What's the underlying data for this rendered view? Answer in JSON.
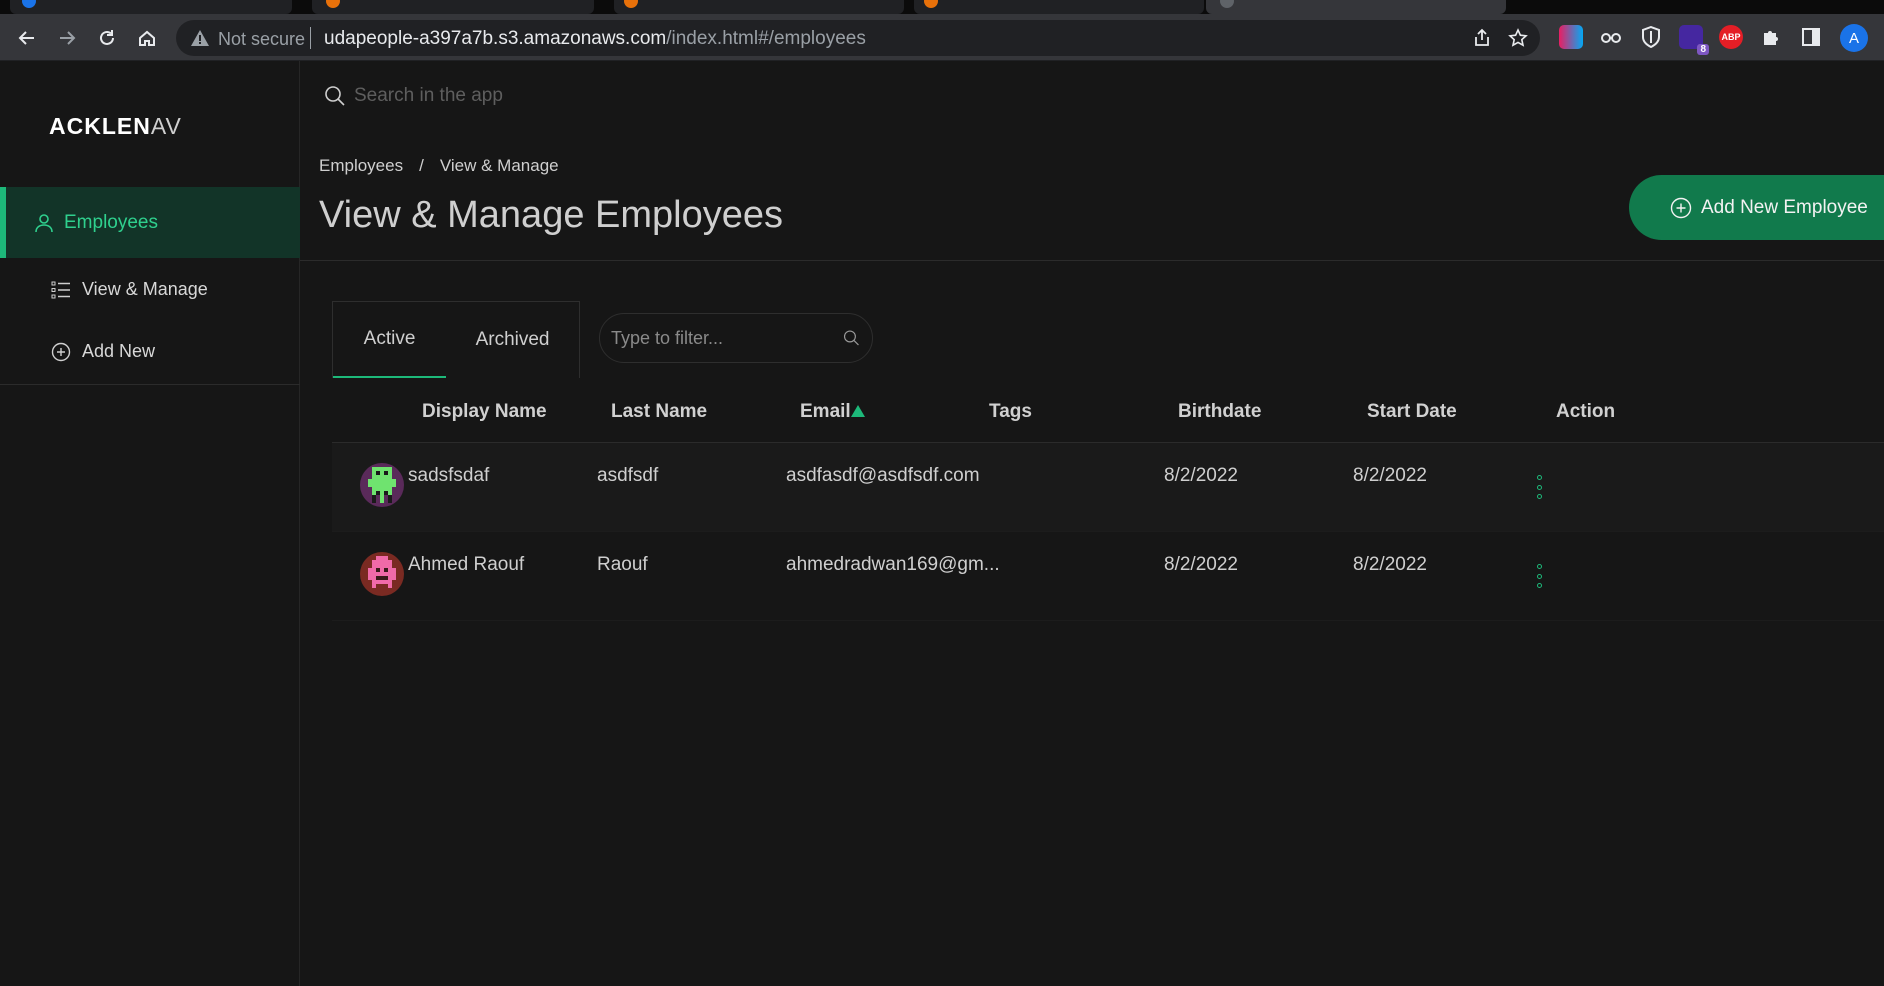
{
  "browser": {
    "secure_label": "Not secure",
    "url_host": "udapeople-a397a7b.s3.amazonaws.com",
    "url_path": "/index.html#/employees",
    "profile_initial": "A",
    "extension_badge": "8",
    "abp_label": "ABP"
  },
  "app": {
    "logo_bold": "ACKLEN",
    "logo_thin": "AV"
  },
  "sidebar": {
    "section_label": "Employees",
    "items": [
      {
        "label": "View & Manage"
      },
      {
        "label": "Add New"
      }
    ]
  },
  "search": {
    "placeholder": "Search in the app"
  },
  "breadcrumb": {
    "items": [
      "Employees",
      "View & Manage"
    ],
    "separator": "/"
  },
  "page": {
    "title": "View & Manage Employees",
    "add_button": "Add New Employee"
  },
  "tabs": {
    "active": "Active",
    "archived": "Archived"
  },
  "filter": {
    "placeholder": "Type to filter..."
  },
  "table": {
    "columns": [
      "Display Name",
      "Last Name",
      "Email",
      "Tags",
      "Birthdate",
      "Start Date",
      "Action"
    ],
    "sorted_column": "Email",
    "rows": [
      {
        "display_name": "sadsfsdaf",
        "last_name": "asdfsdf",
        "email": "asdfasdf@asdfsdf.com",
        "tags": "",
        "birthdate": "8/2/2022",
        "start_date": "8/2/2022"
      },
      {
        "display_name": "Ahmed Raouf",
        "last_name": "Raouf",
        "email": "ahmedradwan169@gm...",
        "tags": "",
        "birthdate": "8/2/2022",
        "start_date": "8/2/2022"
      }
    ]
  },
  "colors": {
    "accent": "#1db97a",
    "button_bg": "#117a4c",
    "nav_active_bg": "#123428",
    "page_bg": "#161616"
  }
}
